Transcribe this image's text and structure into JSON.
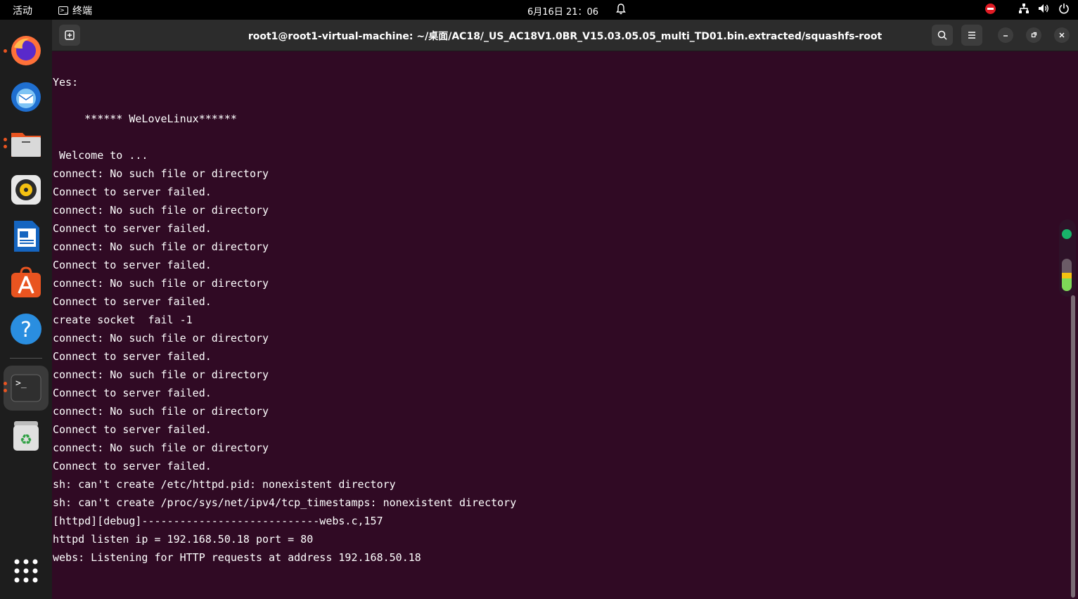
{
  "topbar": {
    "activities": "活动",
    "app_name": "终端",
    "clock": "6月16日  21：06"
  },
  "window": {
    "title": "root1@root1-virtual-machine: ~/桌面/AC18/_US_AC18V1.0BR_V15.03.05.05_multi_TD01.bin.extracted/squashfs-root"
  },
  "dock": {
    "items": [
      "firefox-icon",
      "thunderbird-icon",
      "files-icon",
      "rhythmbox-icon",
      "libreoffice-writer-icon",
      "app-center-icon",
      "help-icon",
      "terminal-icon",
      "trash-icon",
      "app-grid-icon"
    ]
  },
  "colors": {
    "terminal_bg": "#300a24",
    "accent": "#e95420"
  },
  "terminal": {
    "lines": [
      "Yes:",
      "",
      "     ****** WeLoveLinux******",
      "",
      " Welcome to ...",
      "connect: No such file or directory",
      "Connect to server failed.",
      "connect: No such file or directory",
      "Connect to server failed.",
      "connect: No such file or directory",
      "Connect to server failed.",
      "connect: No such file or directory",
      "Connect to server failed.",
      "create socket  fail -1",
      "connect: No such file or directory",
      "Connect to server failed.",
      "connect: No such file or directory",
      "Connect to server failed.",
      "connect: No such file or directory",
      "Connect to server failed.",
      "connect: No such file or directory",
      "Connect to server failed.",
      "sh: can't create /etc/httpd.pid: nonexistent directory",
      "sh: can't create /proc/sys/net/ipv4/tcp_timestamps: nonexistent directory",
      "[httpd][debug]----------------------------webs.c,157",
      "httpd listen ip = 192.168.50.18 port = 80",
      "webs: Listening for HTTP requests at address 192.168.50.18"
    ]
  }
}
